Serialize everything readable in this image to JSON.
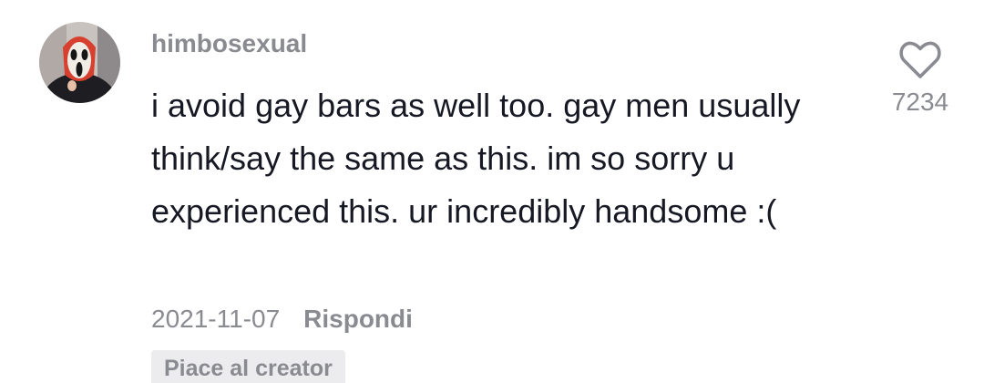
{
  "comment": {
    "username": "himbosexual",
    "text": "i avoid gay bars as well too. gay men usually think/say the same as this. im so sorry u experienced this. ur incredibly handsome :(",
    "date": "2021-11-07",
    "reply_label": "Rispondi",
    "creator_badge": "Piace al creator",
    "like_count": "7234",
    "like_icon": "heart-outline-icon",
    "avatar_icon": "ghostface-mask-avatar"
  },
  "colors": {
    "primary_text": "#161823",
    "secondary_text": "#8a8b91",
    "badge_background": "#ececee"
  }
}
